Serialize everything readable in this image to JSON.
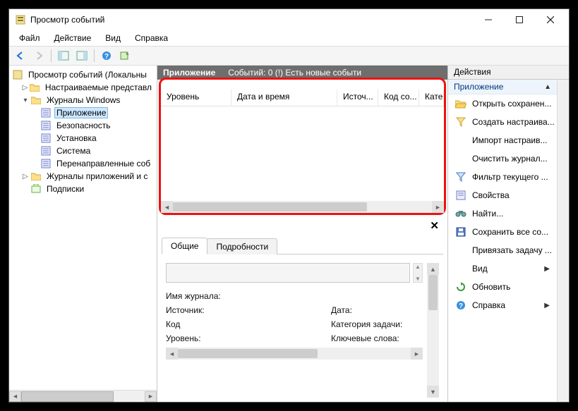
{
  "window": {
    "title": "Просмотр событий"
  },
  "menu": {
    "file": "Файл",
    "action": "Действие",
    "view": "Вид",
    "help": "Справка"
  },
  "tree": {
    "root": "Просмотр событий (Локальны",
    "custom": "Настраиваемые представл",
    "journals": "Журналы Windows",
    "j_app": "Приложение",
    "j_sec": "Безопасность",
    "j_setup": "Установка",
    "j_sys": "Система",
    "j_fwd": "Перенаправленные соб",
    "appjournals": "Журналы приложений и с",
    "subs": "Подписки"
  },
  "center": {
    "title": "Приложение",
    "subtitle": "Событий: 0 (!) Есть новые событи",
    "col_level": "Уровень",
    "col_datetime": "Дата и время",
    "col_source": "Источ...",
    "col_code": "Код со...",
    "col_cat": "Катег"
  },
  "tabs": {
    "general": "Общие",
    "details": "Подробности"
  },
  "details": {
    "logname": "Имя журнала:",
    "source": "Источник:",
    "date": "Дата:",
    "code": "Код",
    "taskcat": "Категория задачи:",
    "level": "Уровень:",
    "keywords": "Ключевые слова:"
  },
  "actions": {
    "title": "Действия",
    "sub": "Приложение",
    "open": "Открыть сохранен...",
    "create": "Создать настраива...",
    "import": "Импорт настраив...",
    "clear": "Очистить журнал...",
    "filter": "Фильтр текущего ...",
    "props": "Свойства",
    "find": "Найти...",
    "saveall": "Сохранить все со...",
    "attach": "Привязать задачу ...",
    "view": "Вид",
    "refresh": "Обновить",
    "help": "Справка"
  }
}
